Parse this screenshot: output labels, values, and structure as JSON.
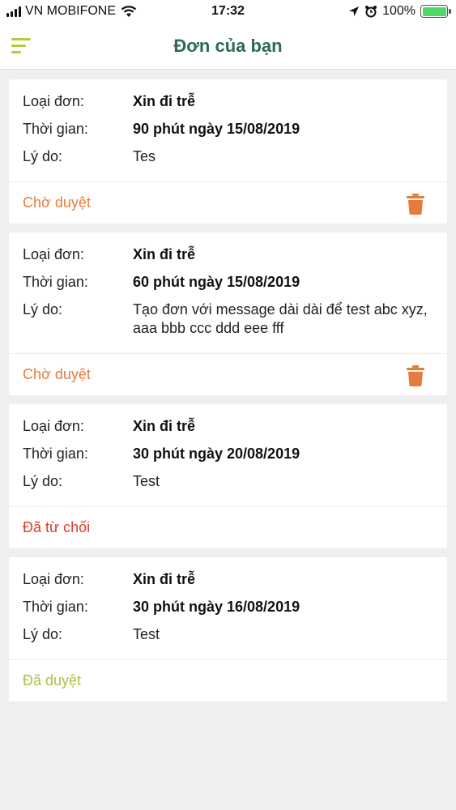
{
  "status_bar": {
    "carrier": "VN MOBIFONE",
    "time": "17:32",
    "battery": "100%",
    "icons": [
      "signal-icon",
      "wifi-icon",
      "location-icon",
      "alarm-icon",
      "battery-icon"
    ]
  },
  "header": {
    "title": "Đơn của bạn",
    "menu_icon": "hamburger-menu-icon"
  },
  "labels": {
    "type": "Loại đơn:",
    "time": "Thời gian:",
    "reason": "Lý do:"
  },
  "colors": {
    "pending": "#ea7a3a",
    "rejected": "#e03a2e",
    "approved": "#a9c23f",
    "title": "#2e6a55",
    "accent": "#b5c93a"
  },
  "requests": [
    {
      "type": "Xin đi trễ",
      "time": "90 phút ngày 15/08/2019",
      "reason": "Tes",
      "status": "Chờ duyệt",
      "status_kind": "pending",
      "deletable": true
    },
    {
      "type": "Xin đi trễ",
      "time": "60 phút ngày 15/08/2019",
      "reason": "Tạo đơn với message dài dài để test abc xyz, aaa bbb ccc ddd eee fff",
      "status": "Chờ duyệt",
      "status_kind": "pending",
      "deletable": true
    },
    {
      "type": "Xin đi trễ",
      "time": "30 phút ngày 20/08/2019",
      "reason": "Test",
      "status": "Đã từ chối",
      "status_kind": "rejected",
      "deletable": false
    },
    {
      "type": "Xin đi trễ",
      "time": "30 phút ngày 16/08/2019",
      "reason": "Test",
      "status": "Đã duyệt",
      "status_kind": "approved",
      "deletable": false
    }
  ]
}
